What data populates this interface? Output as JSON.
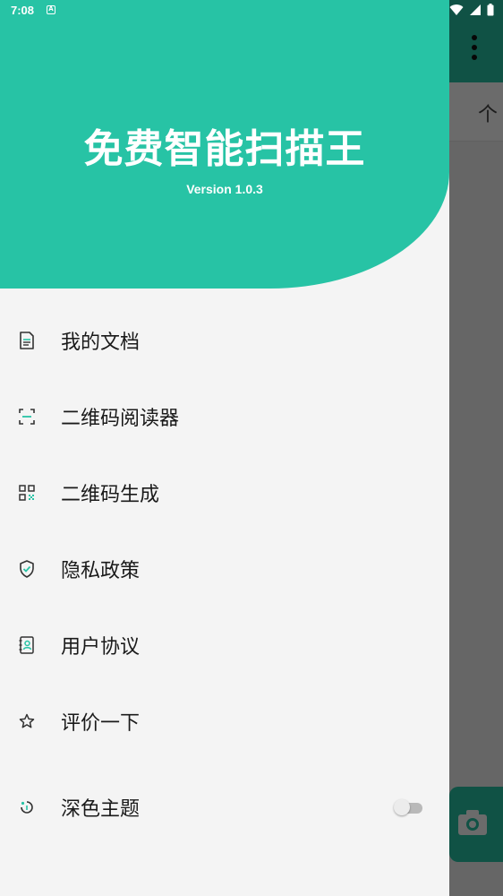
{
  "status_bar": {
    "time": "7:08",
    "notification_glyph": "A"
  },
  "app": {
    "title": "免费智能扫描王",
    "version": "Version 1.0.3",
    "accent_color": "#27c3a5"
  },
  "menu": [
    {
      "label": "我的文档",
      "icon": "document-icon"
    },
    {
      "label": "二维码阅读器",
      "icon": "scan-frame-icon"
    },
    {
      "label": "二维码生成",
      "icon": "qr-code-icon"
    },
    {
      "label": " 隐私政策",
      "icon": "shield-check-icon"
    },
    {
      "label": "用户协议",
      "icon": "contact-book-icon"
    },
    {
      "label": "评价一下",
      "icon": "star-icon"
    },
    {
      "label": "深色主题",
      "icon": "theme-icon",
      "toggle": false
    }
  ],
  "background": {
    "tab_fragment": "个"
  }
}
